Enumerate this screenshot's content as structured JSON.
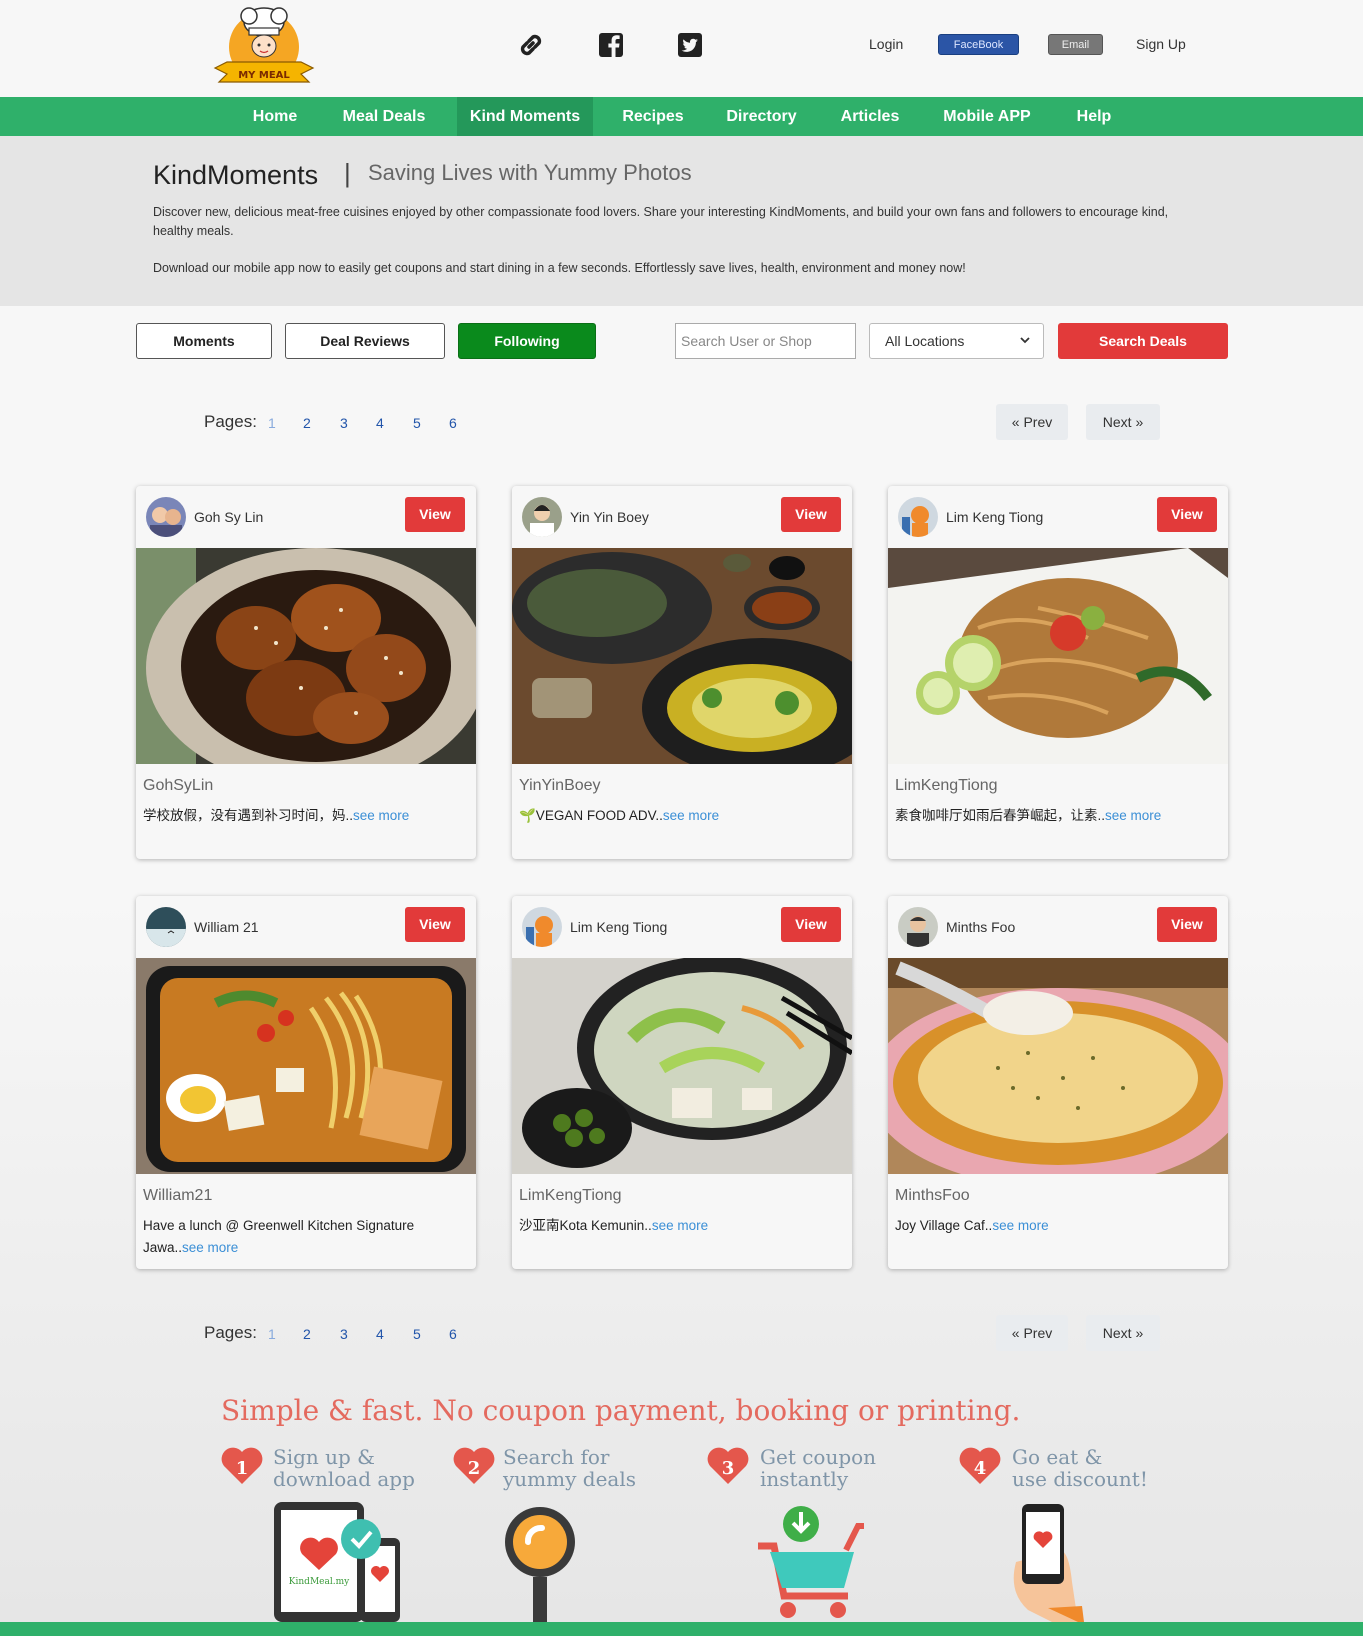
{
  "logo": {
    "text": "MY MEAL"
  },
  "header": {
    "login_label": "Login",
    "facebook_label": "FaceBook",
    "email_label": "Email",
    "signup_label": "Sign Up"
  },
  "nav": {
    "items": [
      {
        "label": "Home"
      },
      {
        "label": "Meal Deals"
      },
      {
        "label": "Kind Moments"
      },
      {
        "label": "Recipes"
      },
      {
        "label": "Directory"
      },
      {
        "label": "Articles"
      },
      {
        "label": "Mobile APP"
      },
      {
        "label": "Help"
      }
    ],
    "active": "Kind Moments"
  },
  "intro": {
    "title": "KindMoments",
    "separator": "|",
    "subtitle": "Saving Lives with Yummy Photos",
    "paragraph1": "Discover new, delicious meat-free cuisines enjoyed by other compassionate food lovers. Share your interesting KindMoments, and build your own fans and followers to encourage kind, healthy meals.",
    "paragraph2": "Download our mobile app now to easily get coupons and start dining in a few seconds. Effortlessly save lives, health, environment and money now!"
  },
  "toolbar": {
    "moments_label": "Moments",
    "deal_reviews_label": "Deal Reviews",
    "following_label": "Following",
    "search_placeholder": "Search User or Shop",
    "location_selected": "All Locations",
    "search_deals_label": "Search Deals"
  },
  "pager": {
    "label": "Pages:",
    "pages": [
      "1",
      "2",
      "3",
      "4",
      "5",
      "6"
    ],
    "current": "1",
    "prev_label": "« Prev",
    "next_label": "Next »"
  },
  "cards": [
    {
      "user": "Goh Sy Lin",
      "name": "GohSyLin",
      "desc": "学校放假，没有遇到补习时间，妈..",
      "more": "see more",
      "view": "View"
    },
    {
      "user": "Yin Yin Boey",
      "name": "YinYinBoey",
      "desc": "🌱VEGAN FOOD ADV..",
      "more": "see more",
      "view": "View"
    },
    {
      "user": "Lim Keng Tiong",
      "name": "LimKengTiong",
      "desc": "素食咖啡厅如雨后春笋崛起，让素..",
      "more": "see more",
      "view": "View"
    },
    {
      "user": "William 21",
      "name": "William21",
      "desc": "Have a lunch @ Greenwell Kitchen Signature Jawa..",
      "more": "see more",
      "view": "View"
    },
    {
      "user": "Lim Keng Tiong",
      "name": "LimKengTiong",
      "desc": "沙亚南Kota Kemunin..",
      "more": "see more",
      "view": "View"
    },
    {
      "user": "Minths Foo",
      "name": "MinthsFoo",
      "desc": "Joy Village Caf..",
      "more": "see more",
      "view": "View"
    }
  ],
  "promo": {
    "title": "Simple & fast.  No coupon payment, booking or printing.",
    "steps": [
      {
        "num": "1",
        "line1": "Sign up &",
        "line2": "download app"
      },
      {
        "num": "2",
        "line1": "Search for",
        "line2": "yummy deals"
      },
      {
        "num": "3",
        "line1": "Get coupon",
        "line2": "instantly"
      },
      {
        "num": "4",
        "line1": "Go eat &",
        "line2": "use discount!"
      }
    ],
    "app_logo_text": "KindMeal.my"
  },
  "colors": {
    "brand_green": "#2fb06a",
    "accent_red": "#e23a3a",
    "following_green": "#0a8a1c",
    "link_blue": "#3b8fd6"
  },
  "icons": [
    "link-icon",
    "facebook-icon",
    "twitter-icon",
    "chevron-down-icon"
  ]
}
